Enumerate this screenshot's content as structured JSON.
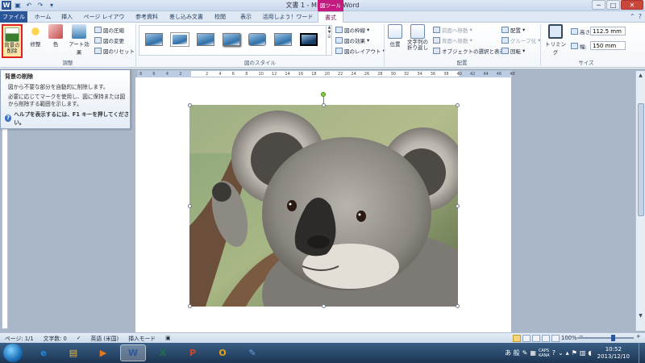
{
  "titlebar": {
    "doc_title": "文書 1 - Microsoft Word",
    "context_group": "図ツール",
    "qat_icons": [
      "word-icon",
      "save-icon",
      "undo-icon",
      "redo-icon",
      "qat-customize-icon"
    ],
    "minimize": "─",
    "maximize": "□",
    "close": "✕"
  },
  "tabs": [
    {
      "label": "ファイル"
    },
    {
      "label": "ホーム"
    },
    {
      "label": "挿入"
    },
    {
      "label": "ページ レイアウト"
    },
    {
      "label": "参考資料"
    },
    {
      "label": "差し込み文書"
    },
    {
      "label": "校閲"
    },
    {
      "label": "表示"
    },
    {
      "label": "活用しよう！ワード"
    },
    {
      "label": "書式"
    }
  ],
  "ribbon": {
    "adjust": {
      "remove_bg": "背景の\n削除",
      "corrections": "修整",
      "color": "色",
      "art_effects": "アート効果",
      "compress": "図の圧縮",
      "change": "図の変更",
      "reset": "図のリセット",
      "group_label": "調整"
    },
    "styles": {
      "group_label": "図のスタイル",
      "border": "図の枠線",
      "effects": "図の効果",
      "layout": "図のレイアウト"
    },
    "arrange": {
      "position": "位置",
      "wrap": "文字列の\n折り返し",
      "bring_forward": "前面へ移動",
      "send_backward": "背面へ移動",
      "selection_pane": "オブジェクトの選択と表示",
      "align": "配置",
      "group": "グループ化",
      "rotate": "回転",
      "group_label": "配置"
    },
    "size": {
      "crop": "トリミング",
      "height_label": "高さ:",
      "height_value": "112.5 mm",
      "width_label": "幅:",
      "width_value": "150 mm",
      "group_label": "サイズ"
    }
  },
  "tooltip": {
    "title": "背景の削除",
    "line1": "図から不要な部分を自動的に削除します。",
    "line2": "必要に応じてマークを使用し、図に保持または図から削除する範囲を示します。",
    "help": "ヘルプを表示するには、F1 キーを押してください。"
  },
  "ruler": {
    "ticks": [
      "8",
      "6",
      "4",
      "2",
      "",
      "2",
      "4",
      "6",
      "8",
      "10",
      "12",
      "14",
      "16",
      "18",
      "20",
      "22",
      "24",
      "26",
      "28",
      "30",
      "32",
      "34",
      "36",
      "38",
      "40",
      "42",
      "44",
      "46",
      "48"
    ]
  },
  "statusbar": {
    "page": "ページ: 1/1",
    "words": "文字数: 0",
    "language": "英語 (米国)",
    "mode": "挿入モード",
    "zoom": "100%",
    "zoom_out": "−",
    "zoom_in": "+"
  },
  "taskbar": {
    "apps": [
      {
        "label": "e",
        "name": "ie-icon",
        "color": "#1e88e5"
      },
      {
        "label": "▤",
        "name": "explorer-icon",
        "color": "#e9b949"
      },
      {
        "label": "▶",
        "name": "media-player-icon",
        "color": "#e07b20"
      },
      {
        "label": "W",
        "name": "word-taskbar-icon",
        "color": "#2b579a"
      },
      {
        "label": "X",
        "name": "excel-icon",
        "color": "#1e7145"
      },
      {
        "label": "P",
        "name": "powerpoint-icon",
        "color": "#d24726"
      },
      {
        "label": "O",
        "name": "outlook-icon",
        "color": "#e8a317"
      },
      {
        "label": "✎",
        "name": "paint-icon",
        "color": "#6aa0d8"
      }
    ],
    "ime": "あ 般",
    "ime_caps": "CAPS\nKANA",
    "time": "10:52",
    "date": "2013/12/10"
  },
  "colors": {
    "file_tab": "#2b579a",
    "context_tab": "#c51a7f",
    "highlight_border": "#e02020"
  }
}
